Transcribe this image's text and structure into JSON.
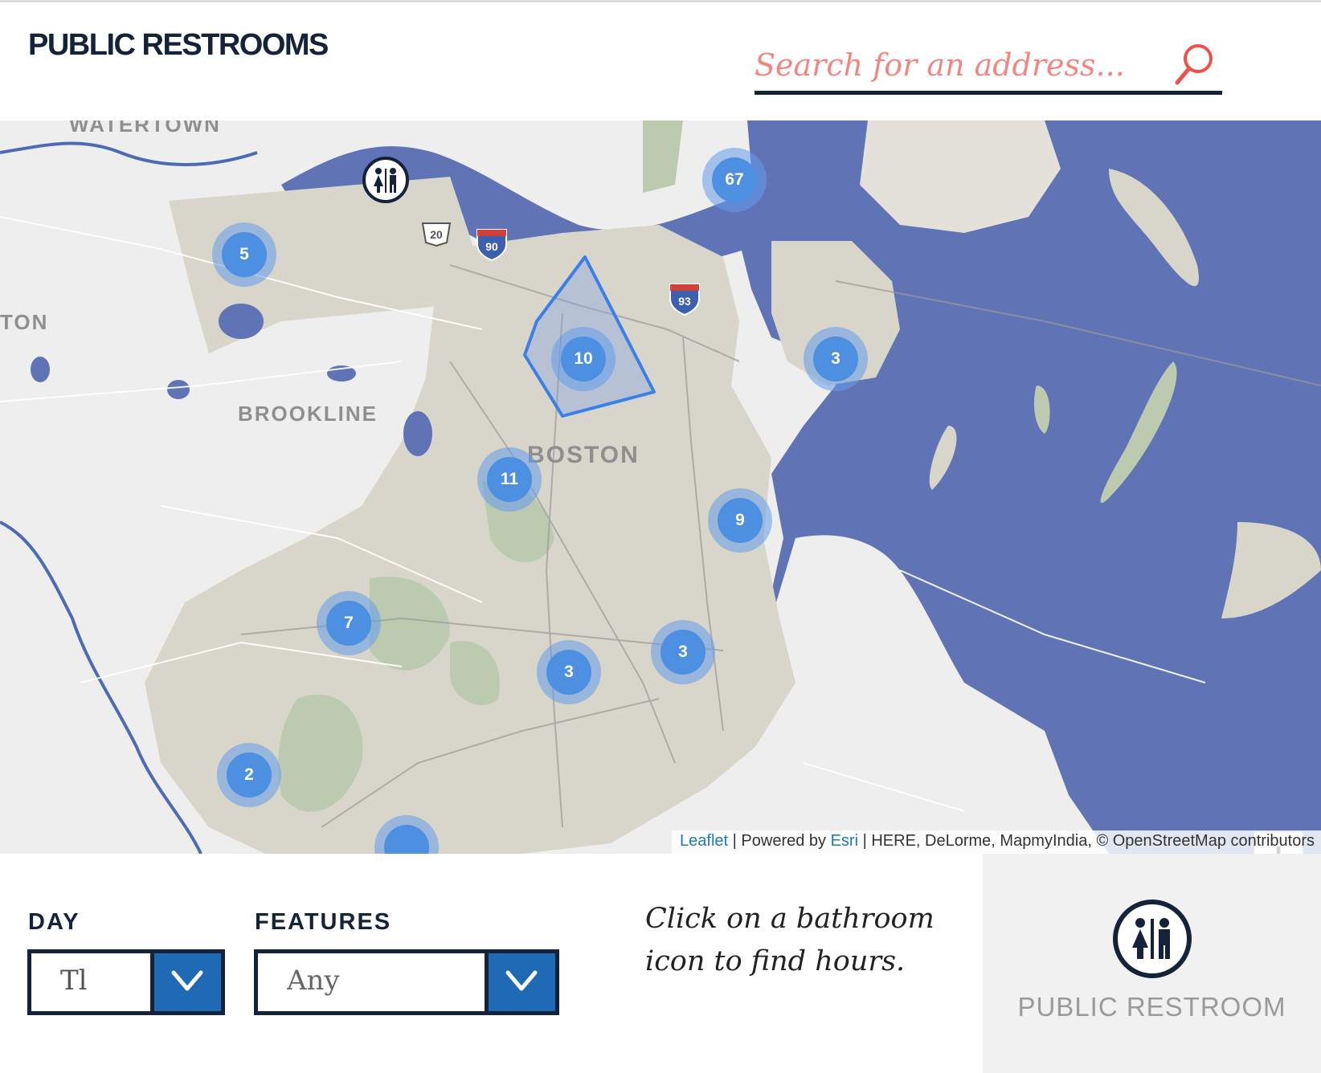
{
  "header": {
    "title": "PUBLIC RESTROOMS",
    "search_placeholder": "Search for an address...",
    "search_icon": "search-icon",
    "close_icon": "close-icon"
  },
  "map": {
    "place_labels": [
      "WATERTOWN",
      "TON",
      "BROOKLINE",
      "BOSTON"
    ],
    "highway_shields": [
      "20",
      "90",
      "93"
    ],
    "clusters": [
      "67",
      "5",
      "10",
      "3",
      "11",
      "9",
      "7",
      "3",
      "3",
      "2"
    ],
    "zoom_in_label": "+",
    "zoom_out_label": "−",
    "attribution": {
      "leaflet": "Leaflet",
      "powered_by": " | Powered by ",
      "esri": "Esri",
      "rest": " | HERE, DeLorme, MapmyIndia, © OpenStreetMap contributors"
    },
    "colors": {
      "water": "#6073b5",
      "land_boston": "#d8d5cb",
      "parks": "#bccbb0",
      "clusters": "#4d8fe0"
    }
  },
  "filters": {
    "day_label": "DAY",
    "day_value": "Tl",
    "features_label": "FEATURES",
    "features_value": "Any"
  },
  "hint": {
    "line1": "Click on a bathroom",
    "line2": "icon to find hours."
  },
  "legend": {
    "icon": "restroom-icon",
    "label": "PUBLIC RESTROOM"
  }
}
